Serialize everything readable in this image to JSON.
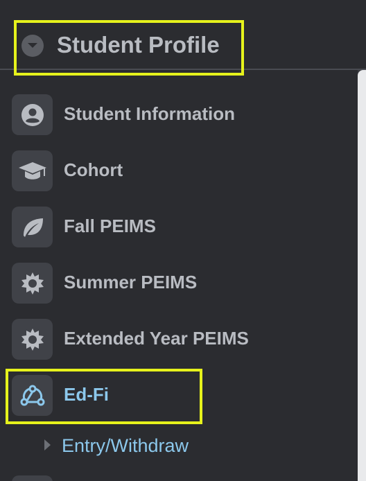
{
  "header": {
    "title": "Student Profile",
    "toggle_icon": "chevron-down-icon"
  },
  "menu": {
    "items": [
      {
        "label": "Student Information",
        "icon": "user-circle-icon",
        "active": false
      },
      {
        "label": "Cohort",
        "icon": "graduation-cap-icon",
        "active": false
      },
      {
        "label": "Fall PEIMS",
        "icon": "leaf-icon",
        "active": false
      },
      {
        "label": "Summer PEIMS",
        "icon": "sun-icon",
        "active": false
      },
      {
        "label": "Extended Year PEIMS",
        "icon": "sun-icon",
        "active": false
      },
      {
        "label": "Ed-Fi",
        "icon": "webhook-icon",
        "active": true
      }
    ],
    "sub_items": [
      {
        "label": "Entry/Withdraw"
      }
    ]
  },
  "colors": {
    "background": "#2b2c30",
    "text": "#b9bcc2",
    "active": "#8cc8ec",
    "highlight": "#e6f21c",
    "tile": "#404248"
  }
}
